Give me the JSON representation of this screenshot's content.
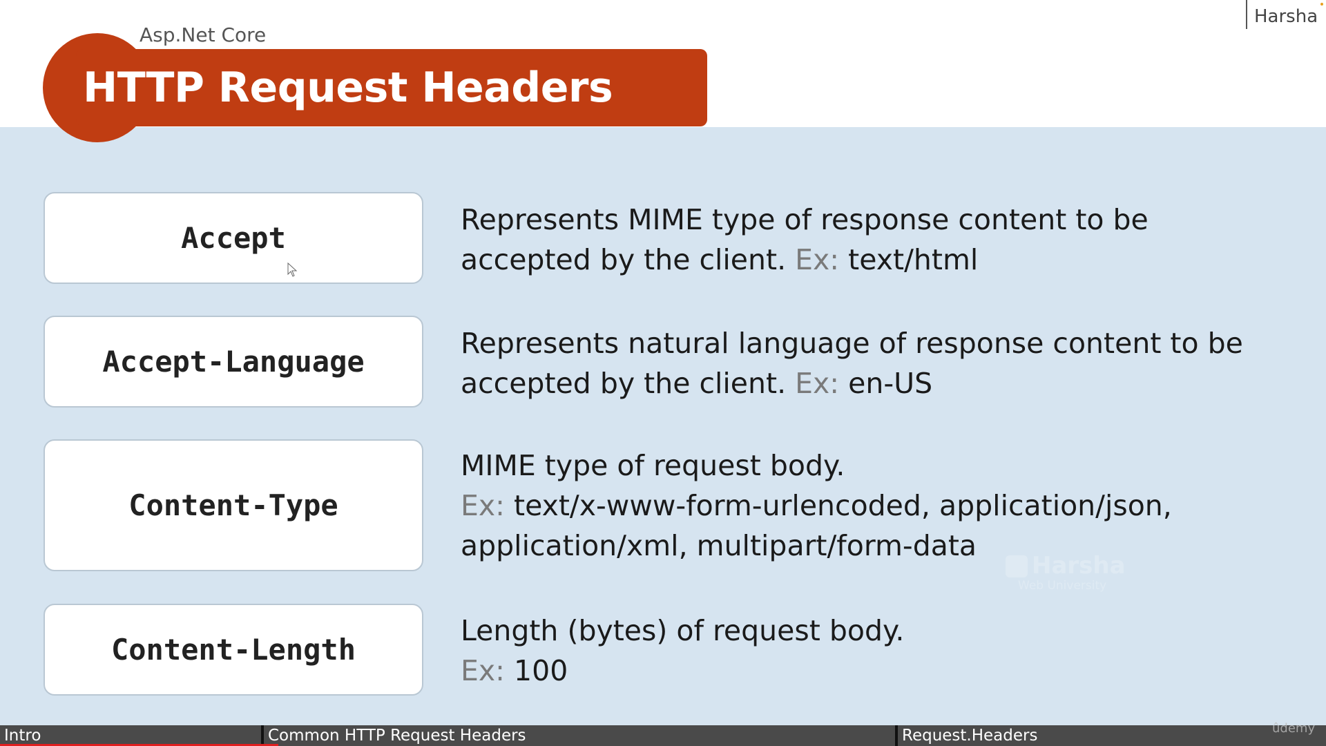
{
  "slide": {
    "course_label": "Asp.Net Core",
    "title": "HTTP Request Headers",
    "presenter": "Harsha",
    "accent_color": "#c03d12"
  },
  "headers": [
    {
      "name": "Accept",
      "desc_lines": [
        {
          "text": "Represents MIME type of response content to be",
          "ex": ""
        },
        {
          "text": "accepted by the client.  ",
          "ex": "Ex:",
          "after": "  text/html"
        }
      ]
    },
    {
      "name": "Accept-Language",
      "desc_lines": [
        {
          "text": "Represents natural language of response content to be",
          "ex": ""
        },
        {
          "text": "accepted by the client.  ",
          "ex": "Ex:",
          "after": " en-US"
        }
      ]
    },
    {
      "name": "Content-Type",
      "desc_lines": [
        {
          "text": "MIME type of request body.",
          "ex": ""
        },
        {
          "text": "",
          "ex": "Ex:",
          "after": " text/x-www-form-urlencoded, application/json,"
        },
        {
          "text": "application/xml, multipart/form-data",
          "ex": ""
        }
      ]
    },
    {
      "name": "Content-Length",
      "desc_lines": [
        {
          "text": "Length (bytes) of request body.",
          "ex": ""
        },
        {
          "text": "",
          "ex": "Ex:",
          "after": " 100"
        }
      ]
    }
  ],
  "watermark": {
    "title": "Harsha",
    "subtitle": "Web University"
  },
  "chapters": [
    {
      "label": "Intro"
    },
    {
      "label": "Common HTTP Request Headers"
    },
    {
      "label": "Request.Headers"
    }
  ],
  "player": {
    "brand": "ûdemy",
    "progress_fraction": 0.21
  }
}
